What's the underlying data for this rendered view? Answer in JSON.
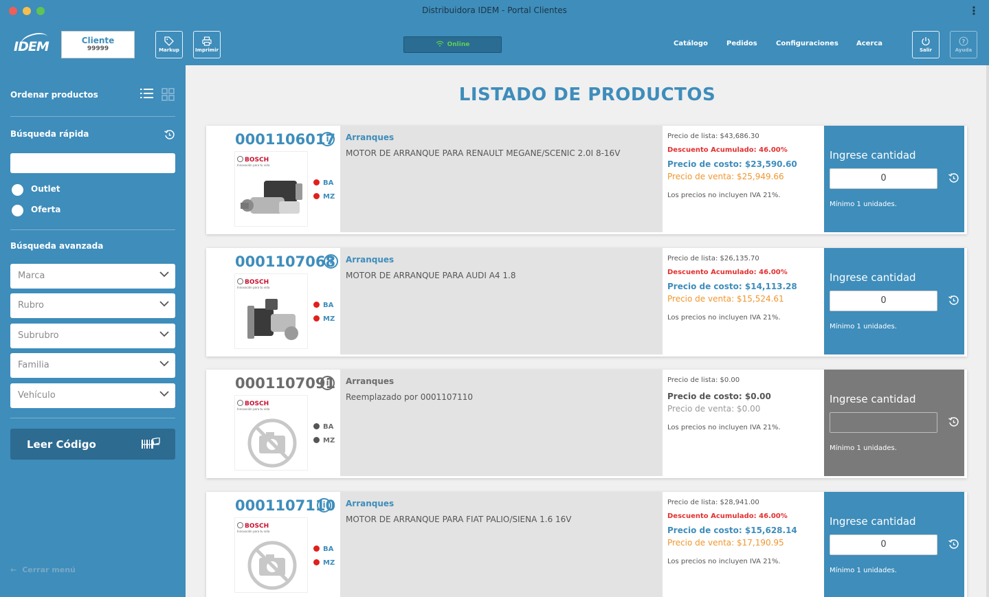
{
  "window": {
    "title": "Distribuidora IDEM - Portal Clientes"
  },
  "header": {
    "logo_text": "IDEM",
    "client_label": "Cliente",
    "client_number": "99999",
    "markup_label": "Markup",
    "print_label": "Imprimir",
    "status": "Online",
    "nav": [
      "Catálogo",
      "Pedidos",
      "Configuraciones",
      "Acerca"
    ],
    "logout_label": "Salir",
    "help_label": "Ayuda"
  },
  "sidebar": {
    "sort_label": "Ordenar productos",
    "quick_search_label": "Búsqueda rápida",
    "quick_search_value": "",
    "options": [
      "Outlet",
      "Oferta"
    ],
    "advanced_label": "Búsqueda avanzada",
    "selects": [
      "Marca",
      "Rubro",
      "Subrubro",
      "Familia",
      "Vehículo"
    ],
    "read_code_label": "Leer Código",
    "close_menu_label": "Cerrar menú"
  },
  "main": {
    "title": "LISTADO DE PRODUCTOS",
    "qty_title": "Ingrese cantidad",
    "min_text": "Mínimo 1 unidades.",
    "iva_note": "Los precios no incluyen IVA 21%.",
    "brand": "BOSCH",
    "brand_tagline": "Innovación para tu vida",
    "products": [
      {
        "code": "0001106017",
        "category": "Arranques",
        "description": "MOTOR DE ARRANQUE PARA RENAULT MEGANE/SCENIC 2.0I 8-16V",
        "stock": [
          "BA",
          "MZ"
        ],
        "list_price": "Precio de lista: $43,686.30",
        "discount": "Descuento Acumulado: 46.00%",
        "cost": "Precio de costo: $23,590.60",
        "sale": "Precio de venta: $25,949.66",
        "qty": "0",
        "image": "starter-motor",
        "available": true
      },
      {
        "code": "0001107068",
        "category": "Arranques",
        "description": "MOTOR DE ARRANQUE PARA AUDI A4 1.8",
        "stock": [
          "BA",
          "MZ"
        ],
        "list_price": "Precio de lista: $26,135.70",
        "discount": "Descuento Acumulado: 46.00%",
        "cost": "Precio de costo: $14,113.28",
        "sale": "Precio de venta: $15,524.61",
        "qty": "0",
        "image": "starter-motor",
        "available": true
      },
      {
        "code": "0001107091",
        "category": "Arranques",
        "description": "Reemplazado por 0001107110",
        "stock": [
          "BA",
          "MZ"
        ],
        "list_price": "Precio de lista: $0.00",
        "discount": "",
        "cost": "Precio de costo: $0.00",
        "sale": "Precio de venta: $0.00",
        "qty": "",
        "image": "no-photo",
        "available": false
      },
      {
        "code": "0001107110",
        "category": "Arranques",
        "description": "MOTOR DE ARRANQUE PARA FIAT PALIO/SIENA 1.6 16V",
        "stock": [
          "BA",
          "MZ"
        ],
        "list_price": "Precio de lista: $28,941.00",
        "discount": "Descuento Acumulado: 46.00%",
        "cost": "Precio de costo: $15,628.14",
        "sale": "Precio de venta: $17,190.95",
        "qty": "0",
        "image": "no-photo",
        "available": true
      }
    ]
  },
  "colors": {
    "primary": "#3e8dbb",
    "dark_primary": "#2d6b91",
    "discount": "#e33030",
    "sale": "#f0962e",
    "stock_dot": "#e1201c",
    "online": "#5fd24f",
    "disabled_panel": "#7a7a7a"
  }
}
